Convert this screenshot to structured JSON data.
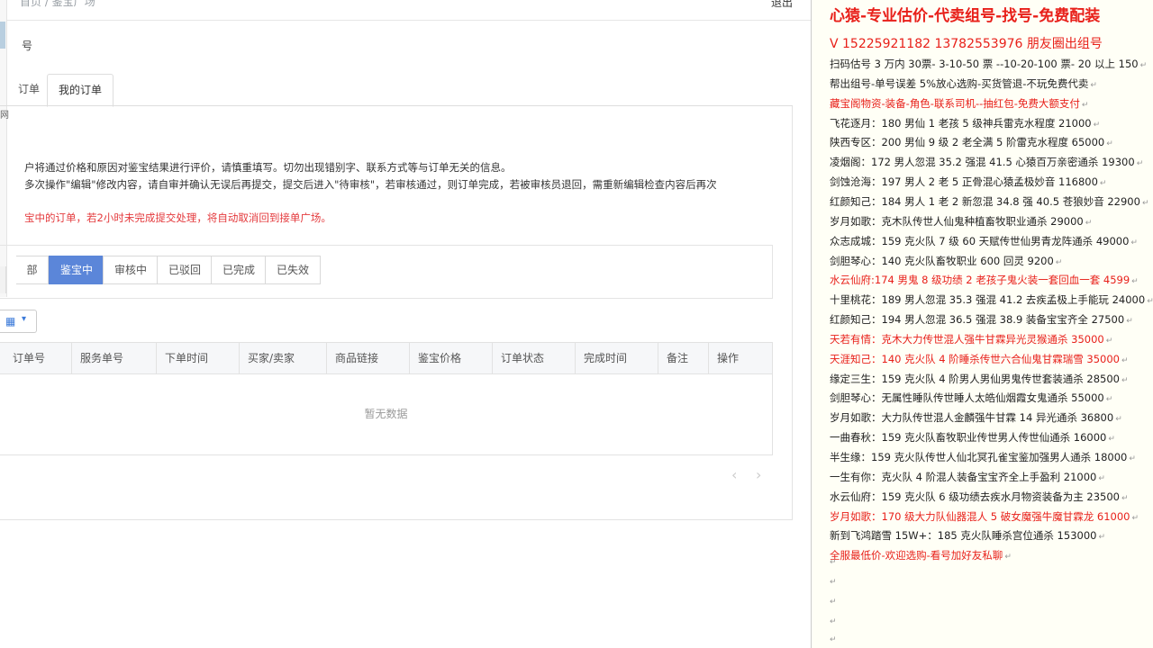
{
  "header": {
    "breadcrumb": "首页 / 鉴宝广场",
    "logout": "退出"
  },
  "sidebar": {
    "fragment": "网",
    "account": "号"
  },
  "tabs": [
    {
      "label": "订单"
    },
    {
      "label": "我的订单"
    }
  ],
  "notes": [
    "户将通过价格和原因对鉴宝结果进行评价，请慎重填写。切勿出现错别字、联系方式等与订单无关的信息。",
    "多次操作\"编辑\"修改内容，请自审并确认无误后再提交，提交后进入\"待审核\"，若审核通过，则订单完成，若被审核员退回，需重新编辑检查内容后再次",
    "宝中的订单，若2小时未完成提交处理，将自动取消回到接单广场。"
  ],
  "filters": [
    {
      "label": "部"
    },
    {
      "label": "鉴宝中"
    },
    {
      "label": "审核中"
    },
    {
      "label": "已驳回"
    },
    {
      "label": "已完成"
    },
    {
      "label": "已失效"
    }
  ],
  "view_toggle": {
    "icon": "grid-icon"
  },
  "table": {
    "columns": [
      "订单号",
      "服务单号",
      "下单时间",
      "买家/卖家",
      "商品链接",
      "鉴宝价格",
      "订单状态",
      "完成时间",
      "备注",
      "操作"
    ],
    "empty_text": "暂无数据"
  },
  "pager": {
    "prev": "‹",
    "next": "›"
  },
  "right_panel": {
    "title": "心猿-专业估价-代卖组号-找号-免费配装",
    "phone": "V 15225921182   13782553976 朋友圈出组号",
    "lines": [
      {
        "text": "扫码估号 3 万内 30票- 3-10-50 票  --10-20-100 票- 20 以上 150",
        "red": false
      },
      {
        "text": "帮出组号-单号误差 5%放心选购-买货管退-不玩免费代卖",
        "red": false
      },
      {
        "text": "藏宝阁物资-装备-角色-联系司机--抽红包-免费大额支付",
        "red": true
      },
      {
        "text": "飞花逐月：180 男仙 1 老孩 5 级神兵雷克水程度 21000",
        "red": false
      },
      {
        "text": "陕西专区：200 男仙 9 级 2 老全满 5 阶雷克水程度 65000",
        "red": false
      },
      {
        "text": "凌烟阁：172 男人忽混 35.2 强混 41.5 心猿百万亲密通杀 19300",
        "red": false
      },
      {
        "text": "剑蚀沧海：197 男人 2 老 5 正骨混心猿孟极妙音 116800",
        "red": false
      },
      {
        "text": "红颜知己：184 男人 1 老 2 新忽混 34.8 强 40.5 苍狼妙音 22900",
        "red": false
      },
      {
        "text": "岁月如歌：克木队传世人仙鬼种植畜牧职业通杀 29000",
        "red": false
      },
      {
        "text": "众志成城：159 克火队 7 级 60 天赋传世仙男青龙阵通杀 49000",
        "red": false
      },
      {
        "text": "剑胆琴心：140 克火队畜牧职业 600 回灵 9200",
        "red": false
      },
      {
        "text": "水云仙府:174 男鬼 8 级功绩 2 老孩子鬼火装一套回血一套 4599",
        "red": true
      },
      {
        "text": "十里桃花：189 男人忽混 35.3 强混 41.2 去疾孟极上手能玩 24000",
        "red": false
      },
      {
        "text": "红颜知己：194 男人忽混 36.5 强混 38.9 装备宝宝齐全 27500",
        "red": false
      },
      {
        "text": "天若有情：克木大力传世混人强牛甘霖异光灵猴通杀 35000",
        "red": true
      },
      {
        "text": "天涯知己：140 克火队 4 阶睡杀传世六合仙鬼甘霖瑞雪 35000",
        "red": true
      },
      {
        "text": "缘定三生：159 克火队 4 阶男人男仙男鬼传世套装通杀 28500",
        "red": false
      },
      {
        "text": "剑胆琴心：无属性睡队传世睡人太皓仙烟霞女鬼通杀 55000",
        "red": false
      },
      {
        "text": "岁月如歌：大力队传世混人金麟强牛甘霖 14 异光通杀 36800",
        "red": false
      },
      {
        "text": "一曲春秋：159 克火队畜牧职业传世男人传世仙通杀 16000",
        "red": false
      },
      {
        "text": "半生缘：159 克火队传世人仙北冥孔雀宝鉴加强男人通杀 18000",
        "red": false
      },
      {
        "text": "一生有你：克火队 4 阶混人装备宝宝齐全上手盈利 21000",
        "red": false
      },
      {
        "text": "水云仙府：159 克火队 6 级功绩去疾水月物资装备为主 23500",
        "red": false
      },
      {
        "text": "岁月如歌：170 级大力队仙器混人 5 破女魔强牛魔甘霖龙 61000",
        "red": true
      },
      {
        "text": "新到飞鸿踏雪 15W+：185 克火队睡杀宫位通杀 153000",
        "red": false
      },
      {
        "text": "全服最低价-欢迎选购-看号加好友私聊",
        "red": true
      }
    ],
    "para_mark": "↵"
  }
}
